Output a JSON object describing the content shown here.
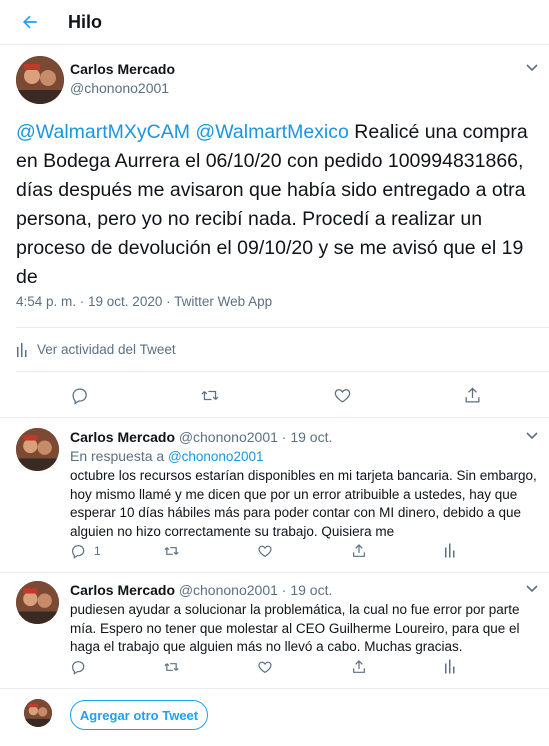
{
  "header": {
    "title": "Hilo"
  },
  "main_tweet": {
    "name": "Carlos Mercado",
    "handle": "@chonono2001",
    "mention1": "@WalmartMXyCAM",
    "mention2": "@WalmartMexico",
    "text": " Realicé una compra en Bodega Aurrera el 06/10/20 con pedido 100994831866, días después me avisaron que había sido entregado a otra persona, pero yo no recibí nada. Procedí a realizar un proceso de devolución el 09/10/20 y se me avisó que el 19 de",
    "meta": "4:54 p. m. · 19 oct. 2020 · Twitter Web App",
    "activity_label": "Ver actividad del Tweet"
  },
  "reply1": {
    "name": "Carlos Mercado",
    "handle_date": "@chonono2001 · 19 oct.",
    "reply_prefix": "En respuesta a",
    "reply_handle": "@chonono2001",
    "text": "octubre los recursos estarían disponibles en mi tarjeta bancaria. Sin embargo, hoy mismo llamé y me dicen que por un error atribuible a ustedes, hay que esperar 10 días hábiles más para poder contar con MI dinero, debido a que alguien no hizo correctamente su trabajo. Quisiera me",
    "reply_count": "1"
  },
  "reply2": {
    "name": "Carlos Mercado",
    "handle_date": "@chonono2001 · 19 oct.",
    "text": "pudiesen ayudar a solucionar la problemática, la cual no fue error por parte mía. Espero no tener que molestar al CEO Guilherme Loureiro, para que el haga el trabajo que alguien más no llevó a cabo. Muchas gracias."
  },
  "composer": {
    "button_label": "Agregar otro Tweet"
  },
  "colors": {
    "accent": "#1da1f2",
    "link": "#1b95e0",
    "muted": "#5b7083",
    "divider": "#ebeef0"
  },
  "icons": [
    "back-arrow-icon",
    "chevron-down-icon",
    "reply-icon",
    "retweet-icon",
    "like-icon",
    "share-icon",
    "activity-bars-icon"
  ]
}
